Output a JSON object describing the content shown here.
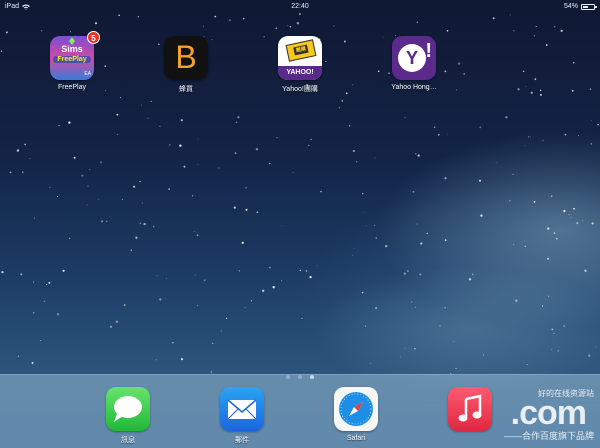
{
  "status_bar": {
    "device": "iPad",
    "time": "22:40",
    "battery_percent": "54%",
    "battery_level": 0.54,
    "wifi_icon": "wifi-icon"
  },
  "home_apps": [
    {
      "id": "freeplay",
      "label": "FreePlay",
      "icon": "sims-freeplay-icon",
      "badge": "5",
      "icon_text": [
        "Sims",
        "FreePlay",
        "EA"
      ]
    },
    {
      "id": "bee",
      "label": "蜂買",
      "icon": "b-letter-icon",
      "icon_text": [
        "B"
      ]
    },
    {
      "id": "yahoo-tg",
      "label": "Yahoo!團購",
      "icon": "yahoo-group-buy-icon",
      "icon_text": [
        "團購",
        "YAHOO!"
      ]
    },
    {
      "id": "yahoo-hk",
      "label": "Yahoo Hong…",
      "icon": "yahoo-hong-kong-icon",
      "icon_text": [
        "Y",
        "!"
      ]
    }
  ],
  "page_indicator": {
    "count": 3,
    "active": 2
  },
  "dock_apps": [
    {
      "id": "messages",
      "label": "訊息",
      "icon": "messages-icon"
    },
    {
      "id": "mail",
      "label": "郵件",
      "icon": "mail-icon"
    },
    {
      "id": "safari",
      "label": "Safari",
      "icon": "safari-icon"
    },
    {
      "id": "music",
      "label": "",
      "icon": "music-icon"
    }
  ],
  "watermark": {
    "top_text": "好的在线资源站",
    "main": ".com",
    "bottom_text": "——合作百度旗下品牌"
  },
  "colors": {
    "badge": "#e9342c",
    "messages": "#2fc446",
    "mail": "#1f86ec",
    "music": "#ef3b55",
    "yahoo_purple": "#5b2a8c"
  }
}
